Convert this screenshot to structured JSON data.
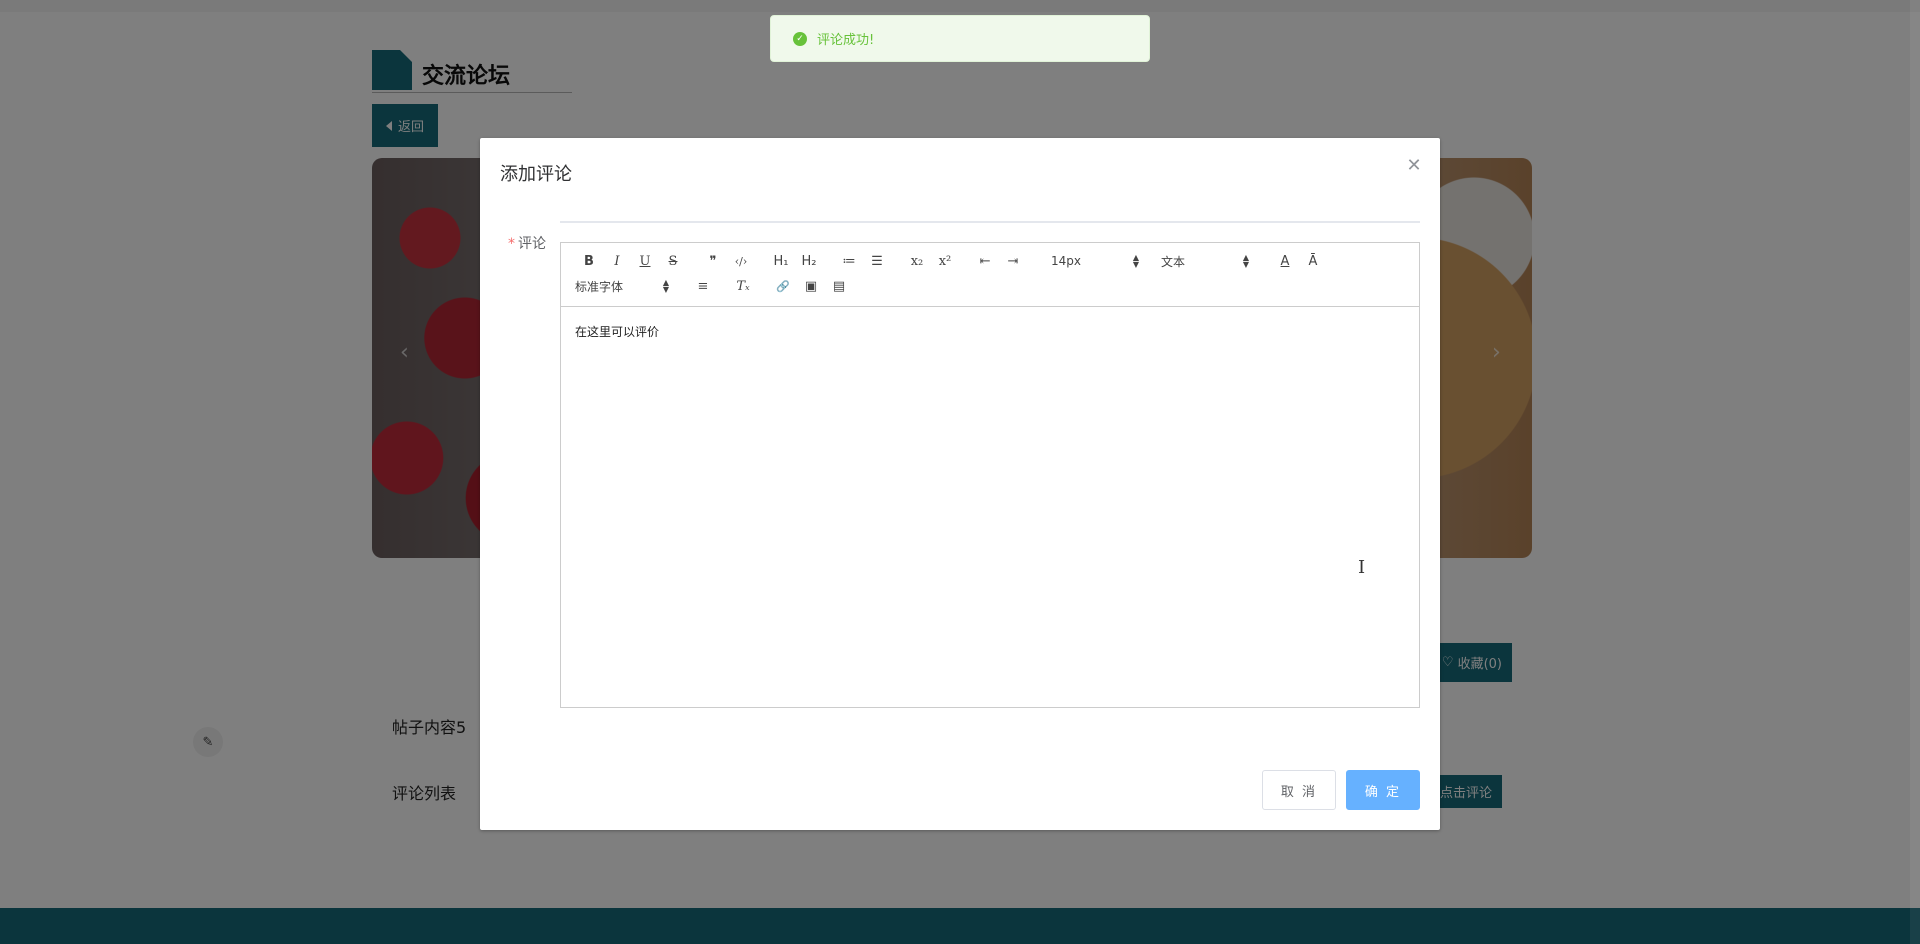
{
  "page": {
    "title": "交流论坛",
    "back_label": "返回",
    "favorite_label": "收藏(0)",
    "post_content": "帖子内容5",
    "comment_list_label": "评论列表",
    "comment_button_label": "点击评论",
    "side_icon": "edit-icon"
  },
  "toast": {
    "message": "评论成功!",
    "icon": "check-circle-icon",
    "color": "#67c23a"
  },
  "dialog": {
    "title": "添加评论",
    "close_icon": "close-icon",
    "field_label": "评论",
    "required_mark": "*",
    "editor": {
      "font_size_value": "14px",
      "header_value": "文本",
      "font_family_value": "标准字体",
      "content": "在这里可以评价",
      "toolbar_row1": [
        {
          "name": "bold",
          "glyph": "B"
        },
        {
          "name": "italic",
          "glyph": "I"
        },
        {
          "name": "underline",
          "glyph": "U"
        },
        {
          "name": "strike",
          "glyph": "S"
        },
        {
          "name": "blockquote",
          "glyph": "❞"
        },
        {
          "name": "code-block",
          "glyph": "‹/›"
        },
        {
          "name": "h1",
          "glyph": "H₁"
        },
        {
          "name": "h2",
          "glyph": "H₂"
        },
        {
          "name": "ordered-list",
          "glyph": "≔"
        },
        {
          "name": "bullet-list",
          "glyph": "☰"
        },
        {
          "name": "subscript",
          "glyph": "x₂"
        },
        {
          "name": "superscript",
          "glyph": "x²"
        },
        {
          "name": "outdent",
          "glyph": "⇤"
        },
        {
          "name": "indent",
          "glyph": "⇥"
        }
      ],
      "toolbar_row2": [
        {
          "name": "align",
          "glyph": "≡"
        },
        {
          "name": "clean",
          "glyph": "Tₓ"
        },
        {
          "name": "link",
          "glyph": "🔗"
        },
        {
          "name": "image",
          "glyph": "▣"
        },
        {
          "name": "video",
          "glyph": "▤"
        }
      ],
      "color_glyph": "A",
      "background_glyph": "Ā"
    },
    "cancel_label": "取 消",
    "confirm_label": "确 定"
  },
  "colors": {
    "brand": "#166a7a",
    "primary_light": "#66b1ff",
    "success": "#67c23a"
  }
}
